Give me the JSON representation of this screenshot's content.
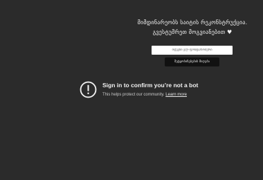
{
  "notice": {
    "line1": "მიმდინარეობს საიტის რეკონსტრუქცია.",
    "line2": "გვესტუმრეთ მოგვიანებით ♥"
  },
  "form": {
    "input_placeholder": "თქვენი ელ-ფოსტა/ნომერი",
    "submit_label": "შეტყობინებების მიღება"
  },
  "signin": {
    "title": "Sign in to confirm you’re not a bot",
    "subtitle": "This helps protect our community.",
    "learn_more": "Learn more",
    "icon": "alert-circle-icon"
  }
}
